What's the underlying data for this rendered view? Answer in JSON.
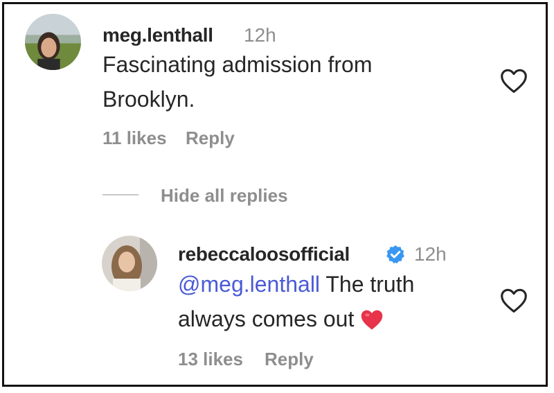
{
  "comment": {
    "username": "meg.lenthall",
    "time": "12h",
    "text_line1": "Fascinating admission from",
    "text_line2": "Brooklyn.",
    "likes": "11 likes",
    "reply_label": "Reply"
  },
  "replies_toggle": "Hide all replies",
  "reply": {
    "username": "rebeccaloosofficial",
    "time": "12h",
    "mention": "@meg.lenthall",
    "text_rest": " The truth",
    "text_line2": "always comes out",
    "likes": "13 likes",
    "reply_label": "Reply"
  },
  "colors": {
    "username": "#262626",
    "muted": "#8e8e8e",
    "mention": "#4a5bd6",
    "verified": "#3897f0",
    "emoji_heart": "#e8334a"
  },
  "icons": {
    "like": "heart-outline-icon",
    "verified": "verified-badge-icon",
    "emoji": "red-heart-emoji"
  }
}
